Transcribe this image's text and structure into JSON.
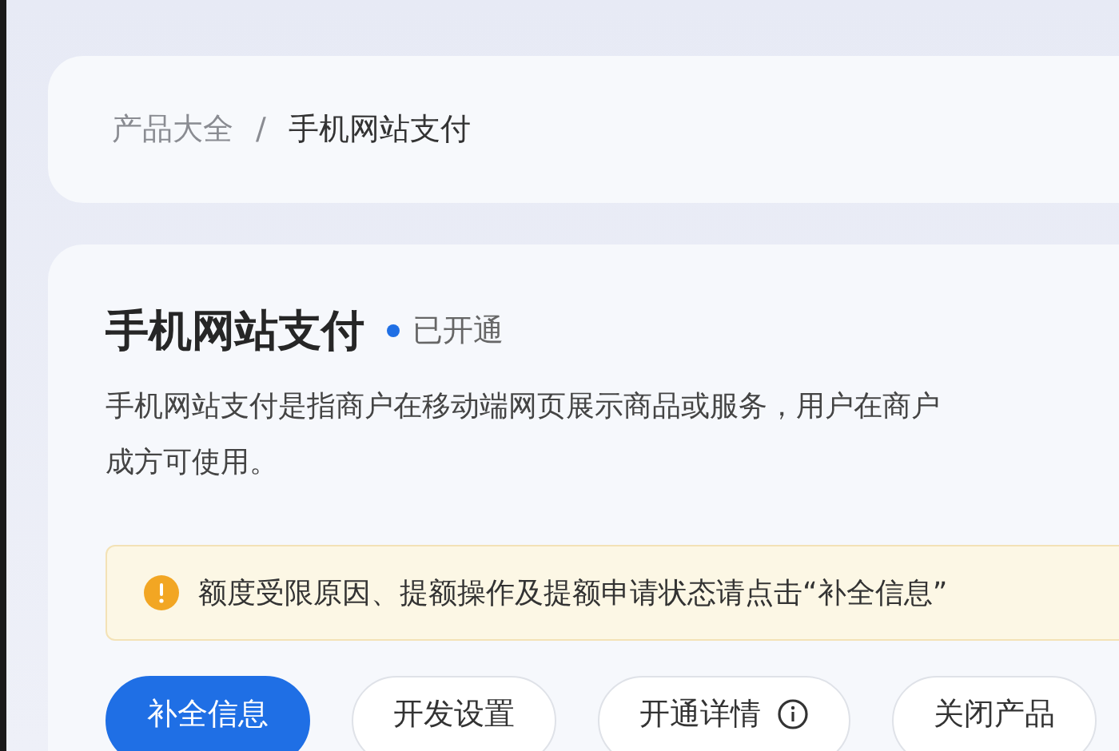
{
  "breadcrumb_separator": "/",
  "breadcrumb": [
    {
      "label": "产品大全",
      "selected": false
    },
    {
      "label": "手机网站支付",
      "selected": true
    }
  ],
  "product": {
    "title": "手机网站支付",
    "status": {
      "label": "已开通",
      "color": "#1f6fe5"
    },
    "description": [
      "手机网站支付是指商户在移动端网页展示商品或服务，用户在商户",
      "成方可使用。"
    ]
  },
  "alert": {
    "text": "额度受限原因、提额操作及提额申请状态请点击“补全信息”"
  },
  "buttons": [
    {
      "label": "补全信息",
      "kind": "primary"
    },
    {
      "label": "开发设置",
      "kind": "plain"
    },
    {
      "label": "开通详情",
      "kind": "info"
    },
    {
      "label": "关闭产品",
      "kind": "plain"
    }
  ]
}
